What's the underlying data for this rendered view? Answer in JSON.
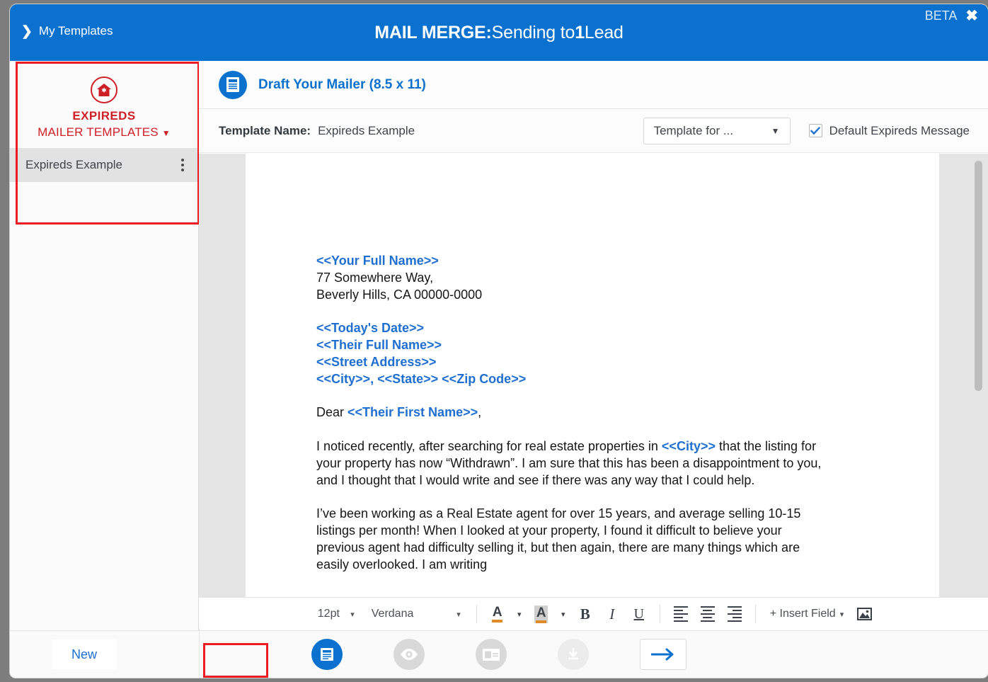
{
  "header": {
    "back_label": "My Templates",
    "back_icon": "chevron-right-icon",
    "title_bold": "MAIL MERGE:",
    "title_rest1": "Sending to",
    "title_count": "1",
    "title_rest2": "Lead",
    "beta_label": "BETA",
    "close_icon": "close-icon"
  },
  "sidebar": {
    "icon": "house-circle-icon",
    "title": "EXPIREDS",
    "subtitle": "MAILER TEMPLATES",
    "subtitle_caret": "▼",
    "templates": [
      {
        "label": "Expireds Example",
        "menu_icon": "kebab-menu-icon",
        "selected": true
      }
    ]
  },
  "panel": {
    "badge_icon": "document-icon",
    "title": "Draft Your Mailer (8.5 x 11)",
    "meta_label": "Template Name:",
    "meta_value": "Expireds Example",
    "select_value": "Template for ...",
    "select_caret": "▼",
    "checkbox_label": "Default Expireds Message",
    "checkbox_checked": true
  },
  "document": {
    "sender_name": "<<Your Full Name>>",
    "sender_street": "77 Somewhere Way,",
    "sender_citystate": "Beverly Hills, CA 00000-0000",
    "date_field": "<<Today's Date>>",
    "their_name": "<<Their Full Name>>",
    "street_address": "<<Street Address>>",
    "city_field": "<<City>>",
    "comma": ",",
    "state_field": "<<State>>",
    "zip_field": "<<Zip Code>>",
    "salutation_prefix": "Dear ",
    "salutation_field": "<<Their First Name>>",
    "salutation_suffix": ",",
    "p1_a": "I noticed recently, after searching for real estate properties in ",
    "p1_city": "<<City>>",
    "p1_b": " that the listing for your property has now “Withdrawn”. I am sure that this has been a disappointment to you, and I thought that I would write and see if there was any way that I could help.",
    "p2": "I’ve been working as a Real Estate agent for over 15 years, and average selling 10-15 listings per month! When I looked at your property, I found it difficult to believe your previous agent had difficulty selling it, but then again, there are many things which are easily overlooked. I am writing"
  },
  "toolbar": {
    "font_size": "12pt",
    "font_family": "Verdana",
    "caret": "▾",
    "text_color_icon": "text-color-icon",
    "highlight_icon": "highlight-color-icon",
    "bold": "B",
    "italic": "I",
    "underline": "U",
    "align_left_icon": "align-left-icon",
    "align_center_icon": "align-center-icon",
    "align_right_icon": "align-right-icon",
    "insert_field_label": "+ Insert Field",
    "image_icon": "insert-image-icon"
  },
  "bottom": {
    "new_label": "New",
    "steps": [
      {
        "icon": "draft-document-icon",
        "state": "active"
      },
      {
        "icon": "preview-eye-icon",
        "state": "grey"
      },
      {
        "icon": "envelope-card-icon",
        "state": "grey"
      },
      {
        "icon": "download-icon",
        "state": "faded"
      }
    ],
    "next_icon": "arrow-right-icon"
  },
  "colors": {
    "brand_blue": "#0a71ce",
    "brand_red": "#cf1f26",
    "highlight_red": "#ec1c24",
    "merge_field_blue": "#1f6fd0"
  }
}
